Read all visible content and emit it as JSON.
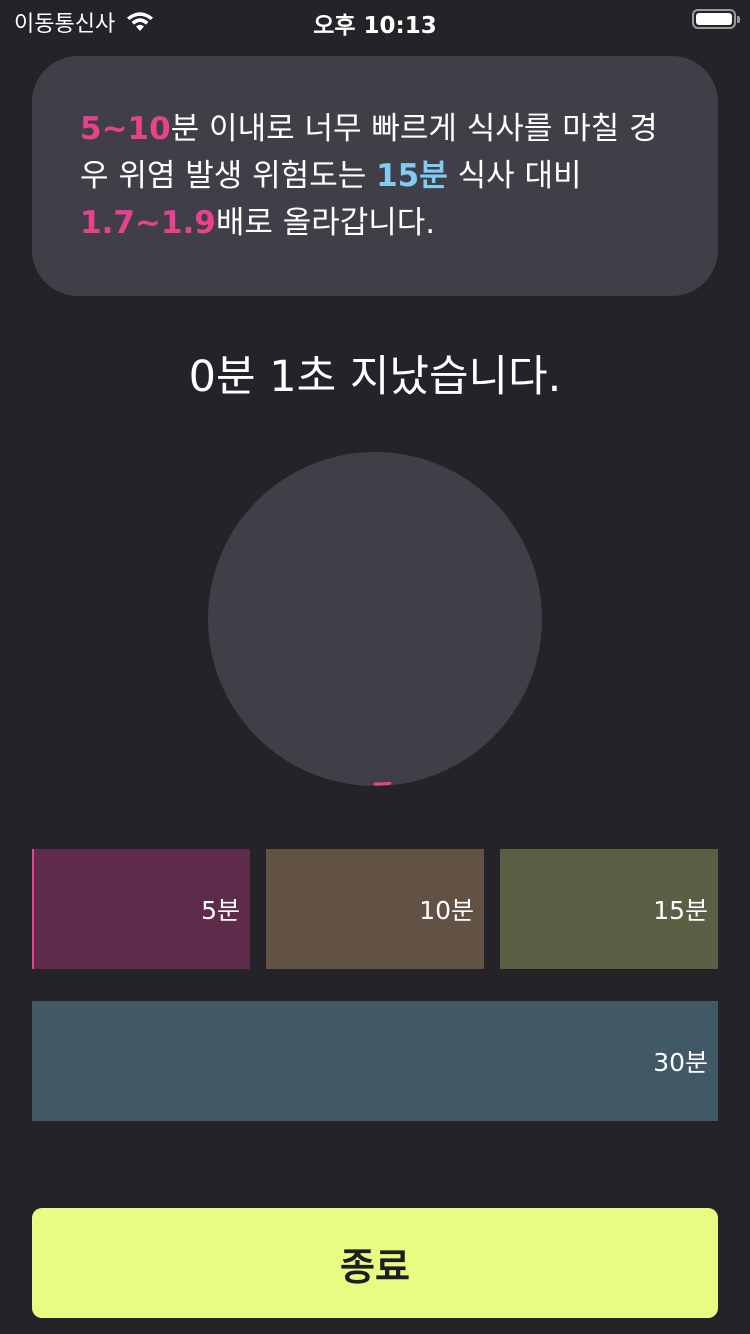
{
  "status_bar": {
    "carrier": "이동통신사",
    "time": "오후 10:13",
    "wifi_icon": "wifi-icon",
    "battery_icon": "battery-icon"
  },
  "info": {
    "part1_highlight": "5~10",
    "part1_text": "분 이내로 너무 빠르게 식사를 마칠 경우 위염 발생 위험도는 ",
    "part2_highlight": "15분",
    "part2_text": " 식사 대비 ",
    "part3_highlight": "1.7~1.9",
    "part3_text": "배로 올라갑니다."
  },
  "timer": {
    "elapsed_text": "0분 1초 지났습니다.",
    "progress_fraction": 0.003
  },
  "presets": {
    "five": "5분",
    "ten": "10분",
    "fifteen": "15분",
    "thirty": "30분"
  },
  "end_button": {
    "label": "종료"
  },
  "colors": {
    "background": "#242328",
    "card": "#403f48",
    "pink": "#e8428f",
    "blue": "#7fcdf5",
    "preset_5": "#5e2b4b",
    "preset_10": "#625244",
    "preset_15": "#5b6045",
    "preset_30": "#415866",
    "end_button": "#e8fc83"
  }
}
